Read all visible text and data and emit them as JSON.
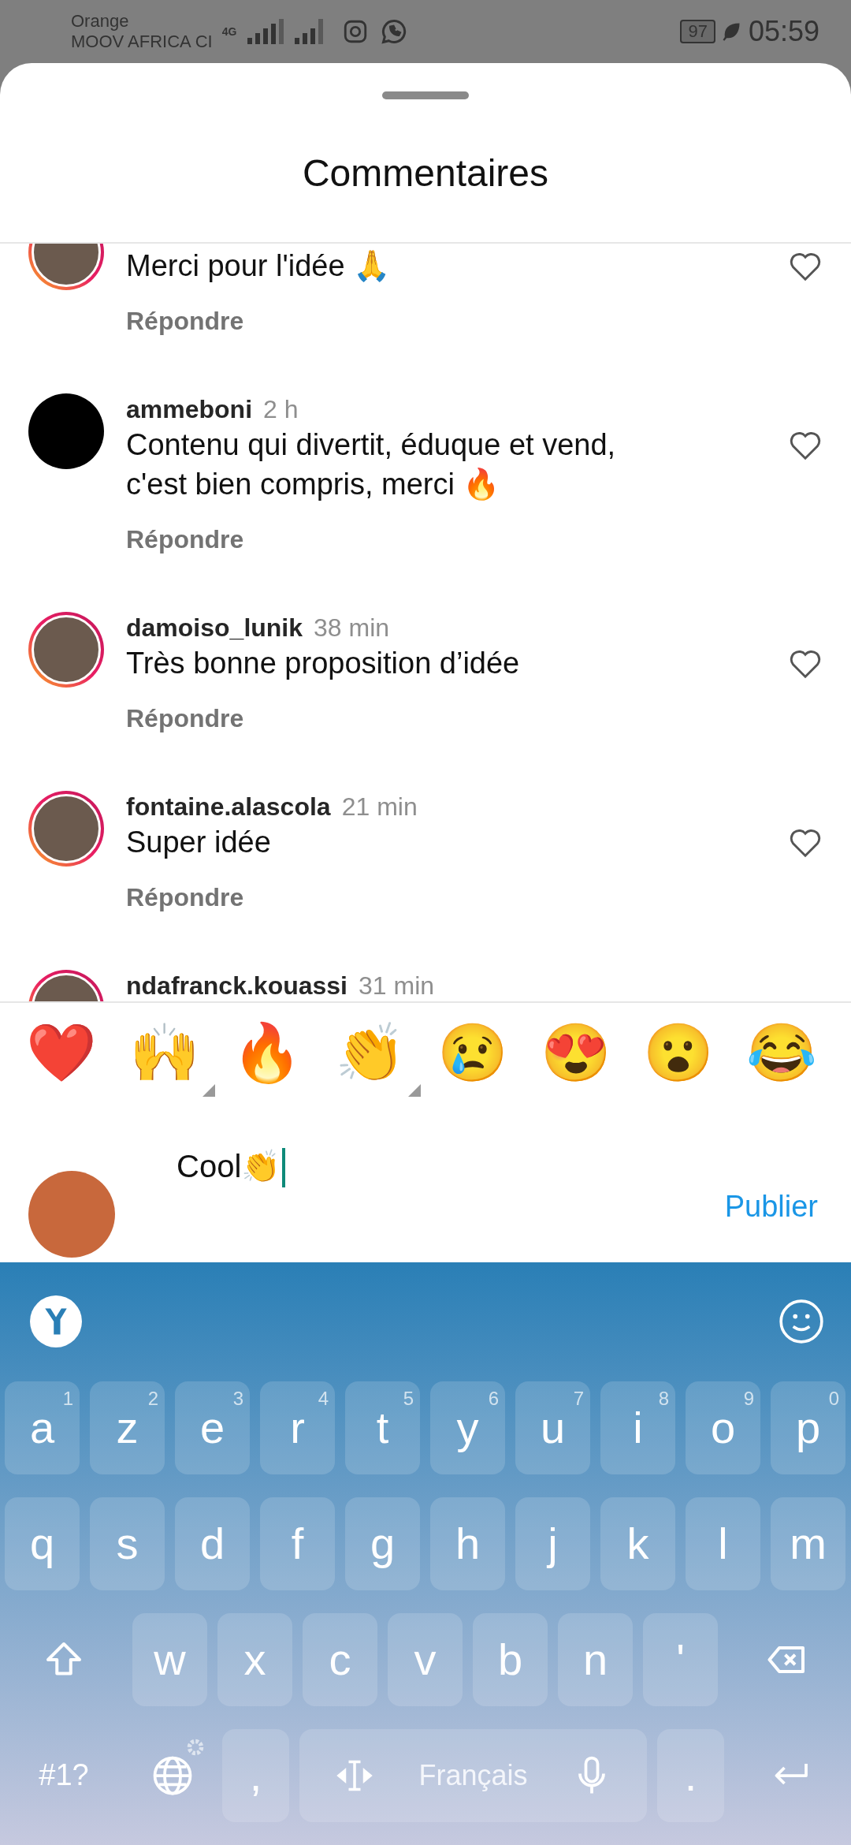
{
  "status_bar": {
    "carrier_lines": [
      "Orange",
      "MOOV AFRICA CI"
    ],
    "network": "4G",
    "battery": "97",
    "time": "05:59"
  },
  "sheet": {
    "title": "Commentaires"
  },
  "comments": [
    {
      "text": "Merci pour l'idée 🙏",
      "reply": "Répondre",
      "story_ring": true,
      "dark_avatar": false
    },
    {
      "username": "ammeboni",
      "time": "2 h",
      "text": "Contenu qui divertit, éduque et vend, c'est bien compris, merci 🔥",
      "reply": "Répondre",
      "story_ring": false,
      "dark_avatar": true
    },
    {
      "username": "damoiso_lunik",
      "time": "38 min",
      "text": "Très bonne proposition d’idée",
      "reply": "Répondre",
      "story_ring": true,
      "dark_avatar": false
    },
    {
      "username": "fontaine.alascola",
      "time": "21 min",
      "text": "Super idée",
      "reply": "Répondre",
      "story_ring": true,
      "dark_avatar": false
    },
    {
      "username": "ndafranck.kouassi",
      "time": "31 min",
      "story_ring": true,
      "dark_avatar": false
    }
  ],
  "reactions": [
    {
      "emoji": "❤️",
      "has_variants": false
    },
    {
      "emoji": "🙌",
      "has_variants": true
    },
    {
      "emoji": "🔥",
      "has_variants": false
    },
    {
      "emoji": "👏",
      "has_variants": true
    },
    {
      "emoji": "😢",
      "has_variants": false
    },
    {
      "emoji": "😍",
      "has_variants": false
    },
    {
      "emoji": "😮",
      "has_variants": false
    },
    {
      "emoji": "😂",
      "has_variants": false
    }
  ],
  "composer": {
    "value": "Cool👏",
    "publish": "Publier"
  },
  "keyboard": {
    "letter_rows": [
      [
        {
          "label": "a",
          "hint": "1"
        },
        {
          "label": "z",
          "hint": "2"
        },
        {
          "label": "e",
          "hint": "3"
        },
        {
          "label": "r",
          "hint": "4"
        },
        {
          "label": "t",
          "hint": "5"
        },
        {
          "label": "y",
          "hint": "6"
        },
        {
          "label": "u",
          "hint": "7"
        },
        {
          "label": "i",
          "hint": "8"
        },
        {
          "label": "o",
          "hint": "9"
        },
        {
          "label": "p",
          "hint": "0"
        }
      ],
      [
        {
          "label": "q"
        },
        {
          "label": "s"
        },
        {
          "label": "d"
        },
        {
          "label": "f"
        },
        {
          "label": "g"
        },
        {
          "label": "h"
        },
        {
          "label": "j"
        },
        {
          "label": "k"
        },
        {
          "label": "l"
        },
        {
          "label": "m"
        }
      ],
      [
        {
          "kind": "shift"
        },
        {
          "label": "w"
        },
        {
          "label": "x"
        },
        {
          "label": "c"
        },
        {
          "label": "v"
        },
        {
          "label": "b"
        },
        {
          "label": "n"
        },
        {
          "label": "'"
        },
        {
          "kind": "backspace"
        }
      ]
    ],
    "bottom_row": {
      "symbols": "#1?",
      "comma": ",",
      "space": "Français",
      "period": "."
    }
  }
}
